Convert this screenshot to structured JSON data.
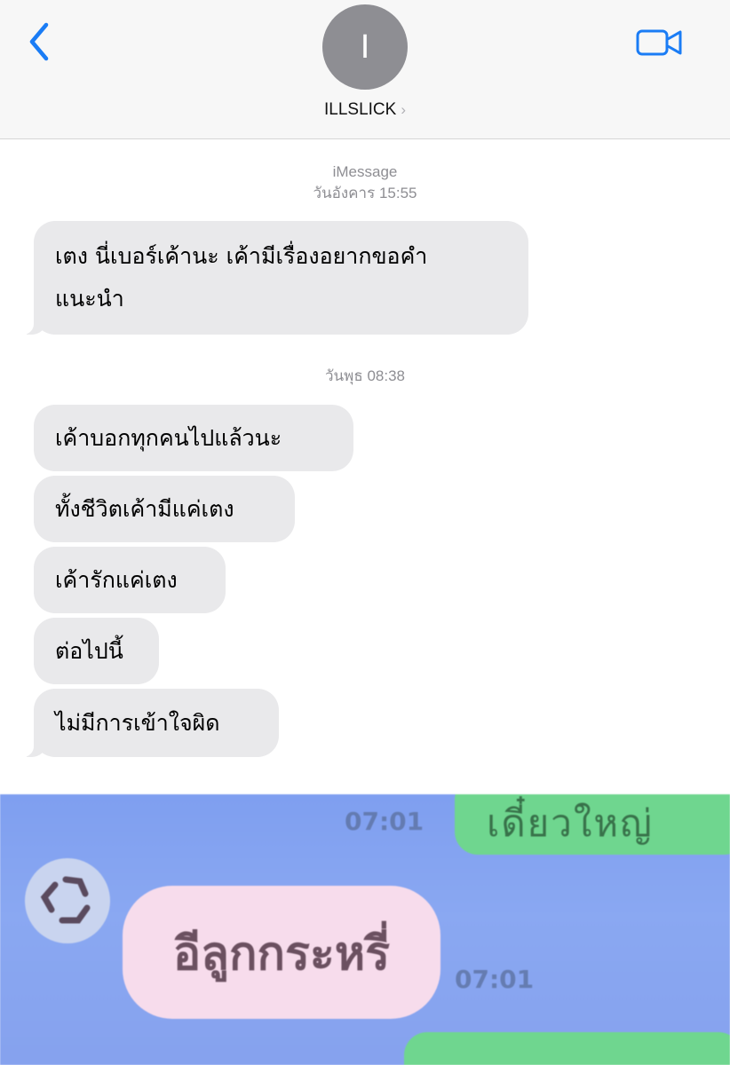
{
  "header": {
    "avatar_initial": "I",
    "contact_name": "ILLSLICK",
    "contact_chevron": "›",
    "icons": {
      "back": "chevron-left-icon",
      "video": "video-camera-icon"
    },
    "accent_color": "#1a7cf5"
  },
  "conversation": {
    "service_label": "iMessage",
    "timestamp_1": "วันอังคาร 15:55",
    "message_1_line_1": "เตง นี่เบอร์เค้านะ เค้ามีเรื่องอยากขอคำ",
    "message_1_line_2": "แนะนำ",
    "timestamp_2": "วันพุธ 08:38",
    "messages": [
      "เค้าบอกทุกคนไปแล้วนะ",
      "ทั้งชีวิตเค้ามีแค่เตง",
      "เค้ารักแค่เตง",
      "ต่อไปนี้",
      "ไม่มีการเข้าใจผิด"
    ],
    "bubble_color": "#e9e9eb"
  },
  "meme": {
    "time_top": "07:01",
    "time_bottom": "07:01",
    "green_text": "เดี๋ยวใหญ่",
    "pink_bubble_text": "อีลูกกระหรี่",
    "colors": {
      "background": "#86a2ee",
      "green_bubble": "#6fd68f",
      "pink_bubble": "#f7dcec"
    }
  }
}
